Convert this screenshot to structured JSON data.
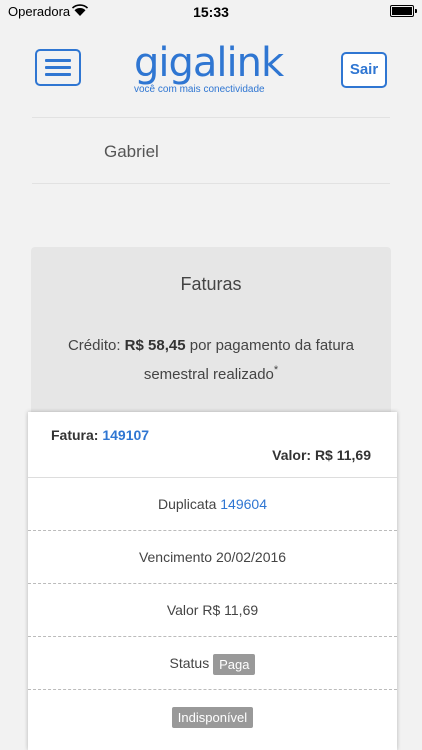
{
  "status_bar": {
    "carrier": "Operadora",
    "time": "15:33"
  },
  "header": {
    "logo_word": "gigalink",
    "logo_tagline": "você com mais conectividade",
    "logout_label": "Sair"
  },
  "user": {
    "name": "Gabriel"
  },
  "invoices": {
    "title": "Faturas",
    "credit_prefix": "Crédito:",
    "credit_amount": "R$ 58,45",
    "credit_suffix": "por pagamento da fatura semestral realizado",
    "credit_mark": "*"
  },
  "invoice": {
    "label": "Fatura:",
    "number": "149107",
    "value_label": "Valor: R$ 11,69",
    "duplicate_label": "Duplicata",
    "duplicate_number": "149604",
    "due_text": "Vencimento 20/02/2016",
    "amount_text": "Valor R$ 11,69",
    "status_label": "Status",
    "status_value": "Paga",
    "availability": "Indisponível"
  },
  "colors": {
    "accent": "#2f76d2",
    "badge": "#999999"
  }
}
